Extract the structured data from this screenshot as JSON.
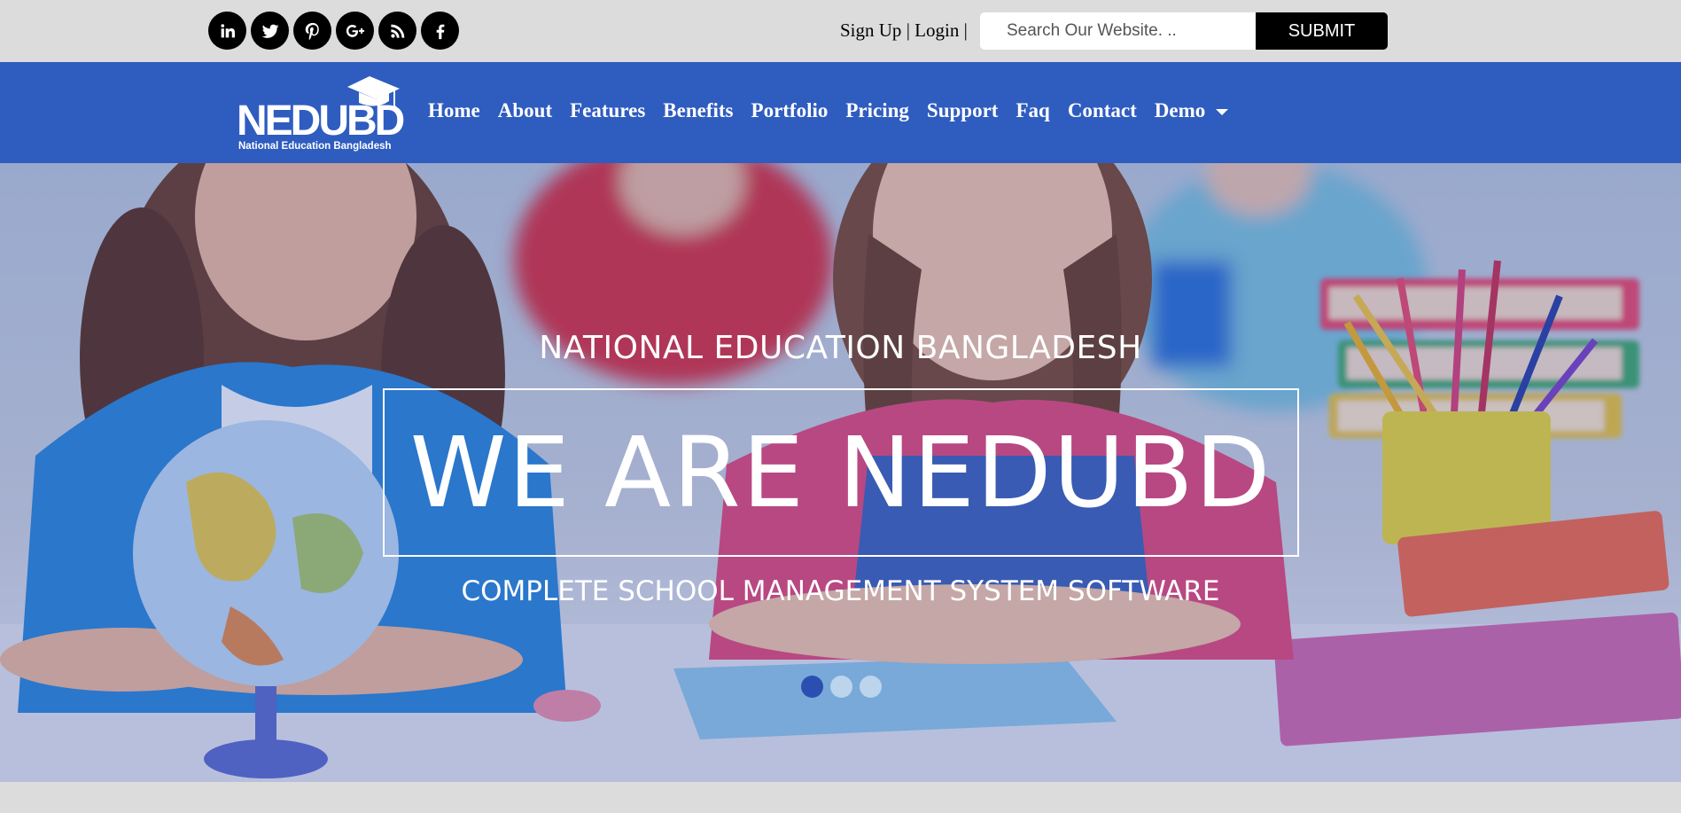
{
  "topbar": {
    "social": [
      {
        "icon": "linkedin-icon",
        "label": "in"
      },
      {
        "icon": "twitter-icon"
      },
      {
        "icon": "pinterest-icon"
      },
      {
        "icon": "google-plus-icon",
        "label": "G+"
      },
      {
        "icon": "rss-icon"
      },
      {
        "icon": "facebook-icon",
        "label": "f"
      }
    ],
    "signup_label": "Sign Up",
    "separator": "|",
    "login_label": "Login",
    "search_placeholder": "Search Our Website. ..",
    "submit_label": "SUBMIT"
  },
  "logo": {
    "wordmark": "NEDUBD",
    "caption": "National Education Bangladesh"
  },
  "nav": {
    "items": [
      "Home",
      "About",
      "Features",
      "Benefits",
      "Portfolio",
      "Pricing",
      "Support",
      "Faq",
      "Contact",
      "Demo"
    ]
  },
  "hero": {
    "subtitle": "NATIONAL EDUCATION BANGLADESH",
    "headline": "WE ARE NEDUBD",
    "tagline": "COMPLETE SCHOOL MANAGEMENT SYSTEM SOFTWARE",
    "slides": 3,
    "active_slide": 1
  },
  "colors": {
    "nav_bg": "#2f5cbf",
    "topbar_bg": "#dcdcdc",
    "active_dot": "#2a4fb0"
  }
}
